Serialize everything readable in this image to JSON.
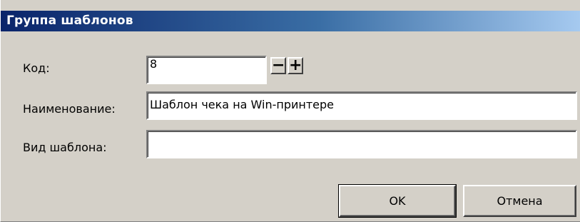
{
  "dialog": {
    "title": "Группа шаблонов"
  },
  "form": {
    "code": {
      "label": "Код:",
      "value": "8",
      "decrement_label": "−",
      "increment_label": "+"
    },
    "name": {
      "label": "Наименование:",
      "value": "Шаблон чека на Win-принтере"
    },
    "template_type": {
      "label": "Вид шаблона:",
      "value": ""
    }
  },
  "buttons": {
    "ok_label": "OK",
    "cancel_label": "Отмена"
  },
  "colors": {
    "titlebar_start": "#0a246a",
    "titlebar_end": "#a6caf0",
    "face": "#d4d0c8"
  }
}
